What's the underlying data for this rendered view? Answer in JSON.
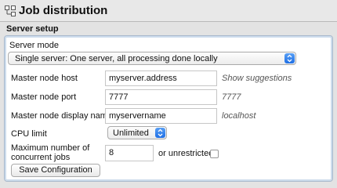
{
  "header": {
    "title": "Job distribution",
    "icon": "network-nodes-icon"
  },
  "section": {
    "title": "Server setup"
  },
  "server_mode": {
    "label": "Server mode",
    "selected": "Single server: One server, all processing done locally"
  },
  "master_host": {
    "label": "Master node host",
    "value": "myserver.address",
    "hint": "Show suggestions"
  },
  "master_port": {
    "label": "Master node port",
    "value": "7777",
    "hint": "7777"
  },
  "master_display_name": {
    "label": "Master node display name",
    "value": "myservername",
    "hint": "localhost"
  },
  "cpu_limit": {
    "label": "CPU limit",
    "selected": "Unlimited"
  },
  "max_jobs": {
    "label_line1": "Maximum number of",
    "label_line2": "concurrent jobs",
    "value": "8",
    "unrestricted_label": "or unrestricted",
    "unrestricted_checked": false
  },
  "actions": {
    "save_label": "Save Configuration"
  },
  "colors": {
    "accent": "#1f6fe5",
    "panel_border": "#a9b9cc"
  }
}
